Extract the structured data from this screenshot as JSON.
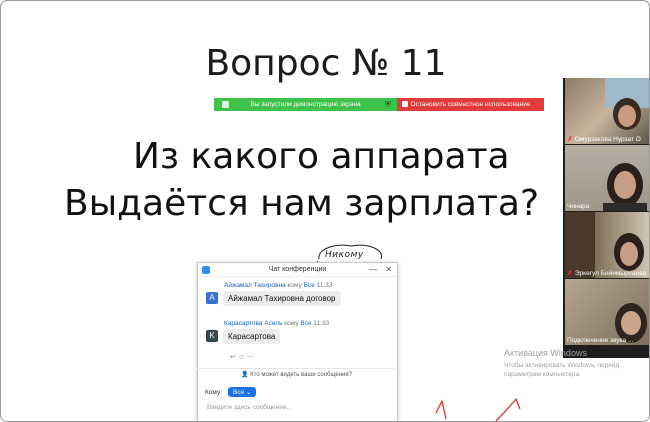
{
  "slide": {
    "title": "Вопрос № 11",
    "question_line1": "Из какого аппарата",
    "question_line2": "Выдаётся нам зарплата?",
    "doodle_text": "Никому"
  },
  "share_toolbar": {
    "status": "Вы запустили демонстрацию экрана",
    "stop_label": "Остановить совместное использование",
    "status_color": "#3ec24a",
    "stop_color": "#e23b3b"
  },
  "chat": {
    "title": "Чат конференции",
    "messages": [
      {
        "avatar": "A",
        "avatar_color": "#3b6fd6",
        "sender": "Айжамал Тахировна",
        "to_prefix": "кому",
        "to": "Все",
        "time": "11:33",
        "text": "Айжамал Тахировна договор"
      },
      {
        "avatar": "K",
        "avatar_color": "#37474f",
        "sender": "Карасартова Асель",
        "to_prefix": "кому",
        "to": "Все",
        "time": "11:33",
        "text": "Карасартова"
      }
    ],
    "who_can_see": "Кто может видеть ваши сообщения?",
    "to_label": "Кому:",
    "to_value": "Все",
    "input_placeholder": "Введите здесь сообщение..."
  },
  "participants": [
    {
      "name": "Омурзакова Нурзат О"
    },
    {
      "name": "Чинара"
    },
    {
      "name": "Эркегул Бийимырсаева"
    },
    {
      "name": "Подключение звука ..."
    }
  ],
  "windows_activation": {
    "title": "Активация Windows",
    "text": "Чтобы активировать Windows, перейд параметрам компьютера."
  }
}
